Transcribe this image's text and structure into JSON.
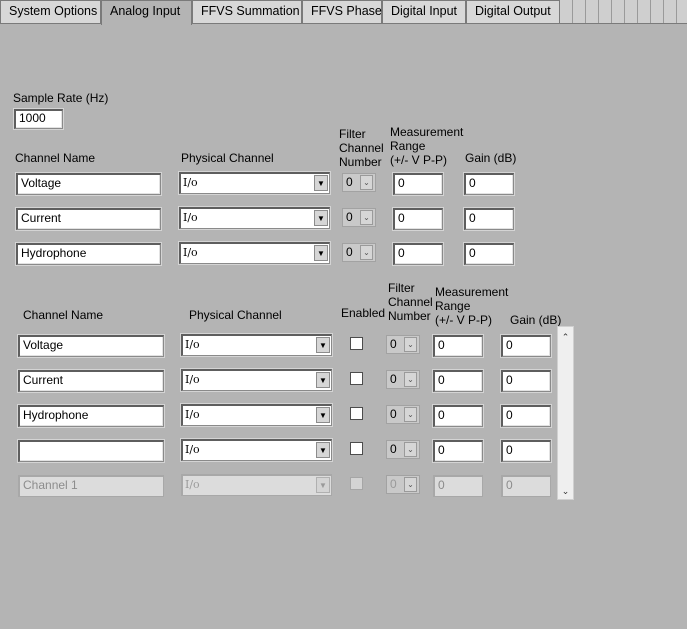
{
  "tabs": [
    {
      "label": "System Options",
      "active": false
    },
    {
      "label": "Analog Input",
      "active": true
    },
    {
      "label": "FFVS Summation",
      "active": false
    },
    {
      "label": "FFVS Phase",
      "active": false
    },
    {
      "label": "Digital Input",
      "active": false
    },
    {
      "label": "Digital Output",
      "active": false
    }
  ],
  "sample_rate": {
    "label": "Sample Rate (Hz)",
    "value": "1000"
  },
  "top_table": {
    "headers": {
      "channel_name": "Channel Name",
      "physical_channel": "Physical Channel",
      "filter": [
        "Filter",
        "Channel",
        "Number"
      ],
      "range": [
        "Measurement",
        "Range",
        "(+/- V P-P)"
      ],
      "gain": "Gain (dB)"
    },
    "rows": [
      {
        "name": "Voltage",
        "io": "I/o",
        "filter": "0",
        "range": "0",
        "gain": "0"
      },
      {
        "name": "Current",
        "io": "I/o",
        "filter": "0",
        "range": "0",
        "gain": "0"
      },
      {
        "name": "Hydrophone",
        "io": "I/o",
        "filter": "0",
        "range": "0",
        "gain": "0"
      }
    ]
  },
  "bottom_table": {
    "headers": {
      "channel_name": "Channel Name",
      "physical_channel": "Physical Channel",
      "enabled": "Enabled",
      "filter": [
        "Filter",
        "Channel",
        "Number"
      ],
      "range": [
        "Measurement",
        "Range",
        "(+/- V P-P)"
      ],
      "gain": "Gain (dB)"
    },
    "rows": [
      {
        "name": "Voltage",
        "io": "I/o",
        "enabled": false,
        "filter": "0",
        "range": "0",
        "gain": "0",
        "disabled": false
      },
      {
        "name": "Current",
        "io": "I/o",
        "enabled": false,
        "filter": "0",
        "range": "0",
        "gain": "0",
        "disabled": false
      },
      {
        "name": "Hydrophone",
        "io": "I/o",
        "enabled": false,
        "filter": "0",
        "range": "0",
        "gain": "0",
        "disabled": false
      },
      {
        "name": "",
        "io": "I/o",
        "enabled": false,
        "filter": "0",
        "range": "0",
        "gain": "0",
        "disabled": false
      },
      {
        "name": "Channel 1",
        "io": "I/o",
        "enabled": false,
        "filter": "0",
        "range": "0",
        "gain": "0",
        "disabled": true
      }
    ]
  },
  "icons": {
    "dropdown": "▼",
    "ring_arrow": "⌄",
    "scroll_up": "⌃",
    "scroll_down": "⌄"
  },
  "colors": {
    "panel": "#b4b4b4",
    "field": "#ffffff",
    "disabled_field": "#dcdcdc",
    "tab_inactive": "#d8d8d8"
  }
}
